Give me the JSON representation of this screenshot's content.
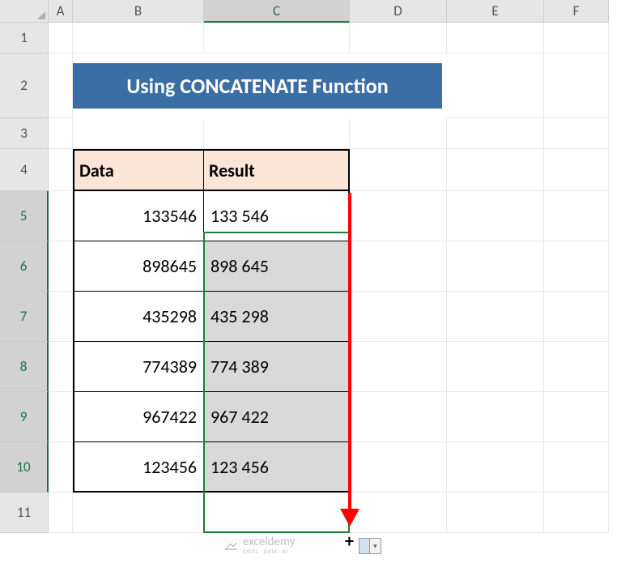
{
  "columns": [
    "A",
    "B",
    "C",
    "D",
    "E",
    "F"
  ],
  "rows": [
    "1",
    "2",
    "3",
    "4",
    "5",
    "6",
    "7",
    "8",
    "9",
    "10",
    "11"
  ],
  "active_column": "C",
  "active_rows": [
    "5",
    "6",
    "7",
    "8",
    "9",
    "10"
  ],
  "title": "Using CONCATENATE Function",
  "table": {
    "headers": {
      "data": "Data",
      "result": "Result"
    },
    "rows": [
      {
        "data": "133546",
        "result": "133 546"
      },
      {
        "data": "898645",
        "result": "898 645"
      },
      {
        "data": "435298",
        "result": "435 298"
      },
      {
        "data": "774389",
        "result": "774 389"
      },
      {
        "data": "967422",
        "result": "967 422"
      },
      {
        "data": "123456",
        "result": "123 456"
      }
    ]
  },
  "watermark": {
    "brand": "exceldemy",
    "tagline": "EXCEL · DATA · BI"
  },
  "chart_data": {
    "type": "table",
    "title": "Using CONCATENATE Function",
    "columns": [
      "Data",
      "Result"
    ],
    "rows": [
      [
        133546,
        "133 546"
      ],
      [
        898645,
        "898 645"
      ],
      [
        435298,
        "435 298"
      ],
      [
        774389,
        "774 389"
      ],
      [
        967422,
        "967 422"
      ],
      [
        123456,
        "123 456"
      ]
    ]
  }
}
